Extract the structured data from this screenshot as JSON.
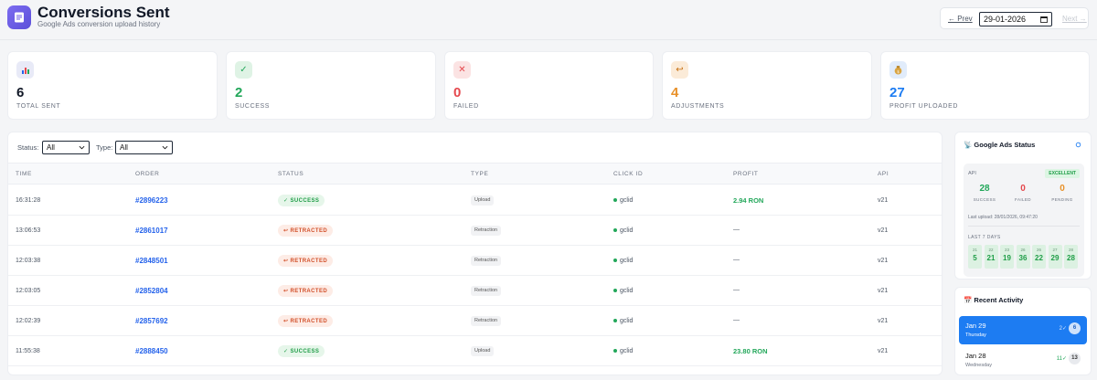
{
  "header": {
    "title": "Conversions Sent",
    "subtitle": "Google Ads conversion upload history",
    "prev_label": "← Prev",
    "date_value": "29-01-2026",
    "next_label": "Next →"
  },
  "stats": [
    {
      "icon": "📊",
      "value": "6",
      "label": "TOTAL SENT",
      "color": "#111827",
      "icon_bg": "#e8eaf7"
    },
    {
      "icon": "✓",
      "value": "2",
      "label": "SUCCESS",
      "color": "#22a75a",
      "icon_bg": "#dff3e5"
    },
    {
      "icon": "✕",
      "value": "0",
      "label": "FAILED",
      "color": "#e5484d",
      "icon_bg": "#fbe3e3"
    },
    {
      "icon": "↩",
      "value": "4",
      "label": "ADJUSTMENTS",
      "color": "#e8912a",
      "icon_bg": "#fbebd8"
    },
    {
      "icon": "💰",
      "value": "27",
      "label": "PROFIT UPLOADED",
      "color": "#1d7cf2",
      "icon_bg": "#e1ecfb"
    }
  ],
  "filters": {
    "status_label": "Status:",
    "status_value": "All",
    "type_label": "Type:",
    "type_value": "All"
  },
  "table": {
    "headers": [
      "TIME",
      "ORDER",
      "STATUS",
      "TYPE",
      "CLICK ID",
      "PROFIT",
      "API"
    ],
    "rows": [
      {
        "time": "16:31:28",
        "order": "#2896223",
        "status": "✓ SUCCESS",
        "status_kind": "success",
        "type": "Upload",
        "click_id": "gclid",
        "profit": "2.94 RON",
        "api": "v21"
      },
      {
        "time": "13:06:53",
        "order": "#2861017",
        "status": "↩ RETRACTED",
        "status_kind": "retracted",
        "type": "Retraction",
        "click_id": "gclid",
        "profit": "—",
        "api": "v21"
      },
      {
        "time": "12:03:38",
        "order": "#2848501",
        "status": "↩ RETRACTED",
        "status_kind": "retracted",
        "type": "Retraction",
        "click_id": "gclid",
        "profit": "—",
        "api": "v21"
      },
      {
        "time": "12:03:05",
        "order": "#2852804",
        "status": "↩ RETRACTED",
        "status_kind": "retracted",
        "type": "Retraction",
        "click_id": "gclid",
        "profit": "—",
        "api": "v21"
      },
      {
        "time": "12:02:39",
        "order": "#2857692",
        "status": "↩ RETRACTED",
        "status_kind": "retracted",
        "type": "Retraction",
        "click_id": "gclid",
        "profit": "—",
        "api": "v21"
      },
      {
        "time": "11:55:38",
        "order": "#2888450",
        "status": "✓ SUCCESS",
        "status_kind": "success",
        "type": "Upload",
        "click_id": "gclid",
        "profit": "23.80 RON",
        "api": "v21"
      }
    ]
  },
  "ads_status": {
    "title": "📡 Google Ads Status",
    "api_label": "API",
    "badge": "EXCELLENT",
    "success_value": "28",
    "success_label": "SUCCESS",
    "failed_value": "0",
    "failed_label": "FAILED",
    "pending_value": "0",
    "pending_label": "PENDING",
    "last_upload": "Last upload: 28/01/2026, 09:47:20",
    "last7_label": "LAST 7 DAYS",
    "days": [
      {
        "d": "21",
        "v": "5"
      },
      {
        "d": "22",
        "v": "21"
      },
      {
        "d": "23",
        "v": "19"
      },
      {
        "d": "26",
        "v": "36"
      },
      {
        "d": "26",
        "v": "22"
      },
      {
        "d": "27",
        "v": "29"
      },
      {
        "d": "28",
        "v": "28"
      }
    ]
  },
  "recent_activity": {
    "title": "📅 Recent Activity",
    "items": [
      {
        "date": "Jan 29",
        "day": "Thursday",
        "check": "2✓",
        "count": "6",
        "active": true
      },
      {
        "date": "Jan 28",
        "day": "Wednesday",
        "check": "11✓",
        "count": "13",
        "active": false
      }
    ]
  }
}
